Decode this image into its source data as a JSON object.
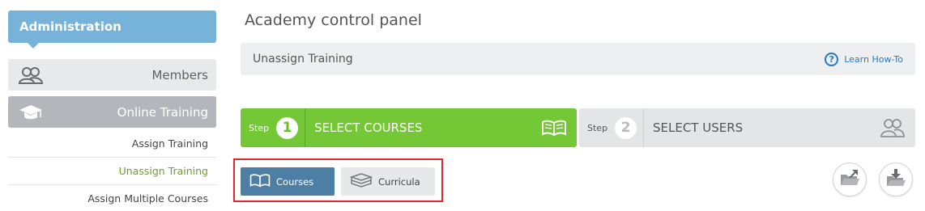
{
  "sidebar": {
    "header": "Administration",
    "items": [
      {
        "label": "Members",
        "icon": "members-icon"
      },
      {
        "label": "Online Training",
        "icon": "graduation-cap-icon"
      }
    ],
    "subitems": [
      {
        "label": "Assign Training"
      },
      {
        "label": "Unassign Training",
        "active": true
      },
      {
        "label": "Assign Multiple Courses"
      }
    ]
  },
  "main": {
    "title": "Academy control panel",
    "action_title": "Unassign Training",
    "howto": {
      "label": "Learn How-To",
      "icon": "question-circle-icon"
    },
    "steps": [
      {
        "prefix": "Step",
        "number": "1",
        "label": "SELECT COURSES",
        "icon": "open-book-icon",
        "active": true
      },
      {
        "prefix": "Step",
        "number": "2",
        "label": "SELECT USERS",
        "icon": "users-icon",
        "active": false
      }
    ],
    "tabs": [
      {
        "label": "Courses",
        "icon": "open-book-icon",
        "selected": true
      },
      {
        "label": "Curricula",
        "icon": "books-stack-icon",
        "selected": false
      }
    ],
    "actions": [
      {
        "icon": "folder-export-icon"
      },
      {
        "icon": "folder-import-icon"
      }
    ]
  },
  "colors": {
    "admin_header": "#77b2d9",
    "step_active": "#75c835",
    "step_inactive": "#e4e5e7",
    "tab_selected": "#4d7ea3",
    "active_link": "#6ea02a",
    "highlight_border": "#e3262e",
    "howto_link": "#2a79c1"
  }
}
